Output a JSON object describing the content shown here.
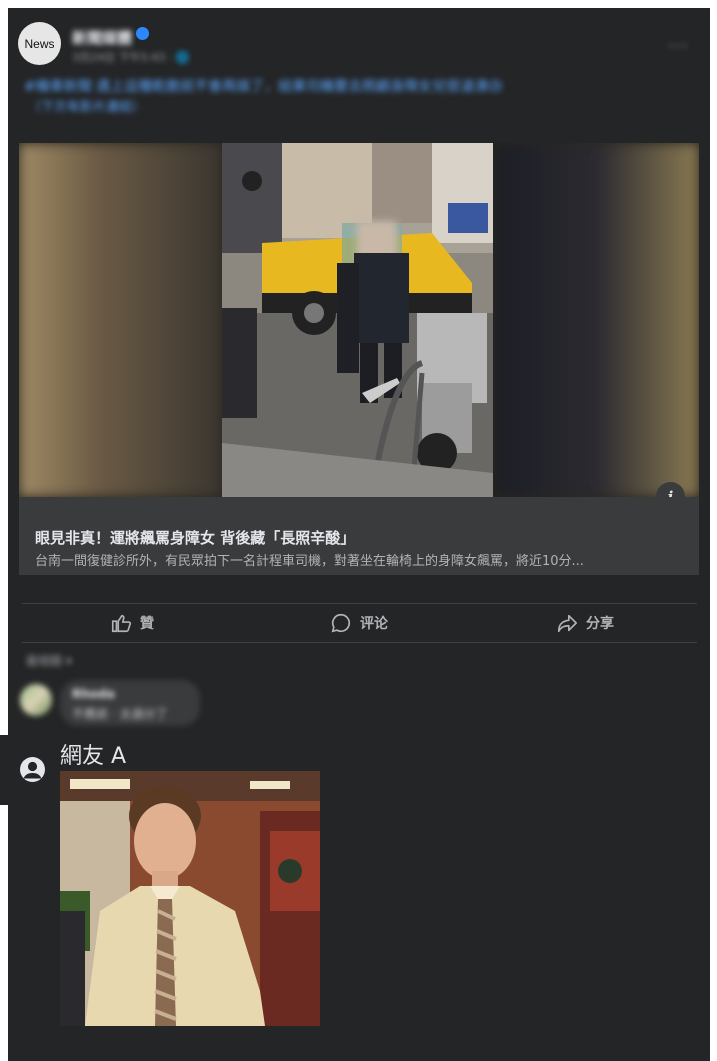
{
  "post": {
    "avatar_text": "News",
    "page_name": "新聞媒體",
    "meta": "3月24日 下午5:43 · 🌐",
    "more": "···",
    "caption_line1": "#機車新聞 遇上這種乾脆就不會再搞了，結果司機要去照顧身障女兒很滄湧😢",
    "caption_line2": "（下方有影片連結）"
  },
  "link": {
    "title": "眼見非真！運將飆罵身障女 背後藏「長照辛酸」",
    "description": "台南一間復健診所外，有民眾拍下一名計程車司機，對著坐在輪椅上的身障女飆罵，將近10分..."
  },
  "actions": {
    "like": "贊",
    "comment": "评论",
    "share": "分享"
  },
  "comments": {
    "filter_label": "最相關 ▾",
    "first_name": "Rhoda",
    "first_text": "不應該 · 太過分了"
  },
  "reply": {
    "user_name": "網友 A"
  },
  "icons": {
    "info": "info-icon",
    "like": "thumbs-up-icon",
    "comment": "comment-bubble-icon",
    "share": "share-arrow-icon",
    "user": "user-avatar-icon"
  },
  "colors": {
    "background": "#242526",
    "link_blue": "#5aa6ff",
    "verified": "#2d88ff"
  }
}
